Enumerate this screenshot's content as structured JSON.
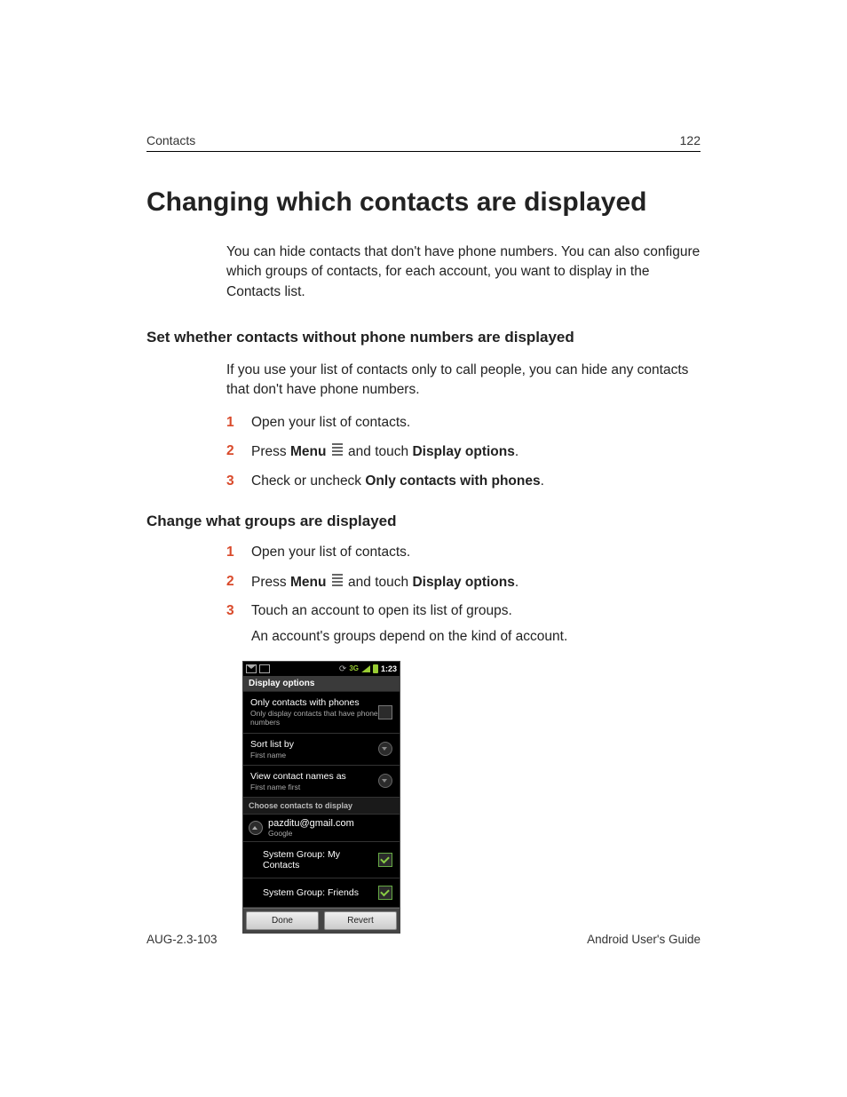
{
  "header": {
    "section": "Contacts",
    "page_number": "122"
  },
  "title": "Changing which contacts are displayed",
  "intro": "You can hide contacts that don't have phone numbers. You can also configure which groups of contacts, for each account, you want to display in the Contacts list.",
  "section1": {
    "heading": "Set whether contacts without phone numbers are displayed",
    "text": "If you use your list of contacts only to call people, you can hide any contacts that don't have phone numbers.",
    "steps": {
      "s1": "Open your list of contacts.",
      "s2_a": "Press ",
      "s2_b": "Menu",
      "s2_c": " and touch ",
      "s2_d": "Display options",
      "s2_e": ".",
      "s3_a": "Check or uncheck ",
      "s3_b": "Only contacts with phones",
      "s3_c": "."
    }
  },
  "section2": {
    "heading": "Change what groups are displayed",
    "steps": {
      "s1": "Open your list of contacts.",
      "s2_a": "Press ",
      "s2_b": "Menu",
      "s2_c": " and touch ",
      "s2_d": "Display options",
      "s2_e": ".",
      "s3": "Touch an account to open its list of groups."
    },
    "sub3": "An account's groups depend on the kind of account."
  },
  "phone": {
    "time": "1:23",
    "titlebar": "Display options",
    "row1": {
      "title": "Only contacts with phones",
      "sub": "Only display contacts that have phone numbers"
    },
    "row2": {
      "title": "Sort list by",
      "sub": "First name"
    },
    "row3": {
      "title": "View contact names as",
      "sub": "First name first"
    },
    "choose_hdr": "Choose contacts to display",
    "account": {
      "name": "pazditu@gmail.com",
      "type": "Google"
    },
    "group1": "System Group: My Contacts",
    "group2": "System Group: Friends",
    "done": "Done",
    "revert": "Revert"
  },
  "footer": {
    "left": "AUG-2.3-103",
    "right": "Android User's Guide"
  }
}
